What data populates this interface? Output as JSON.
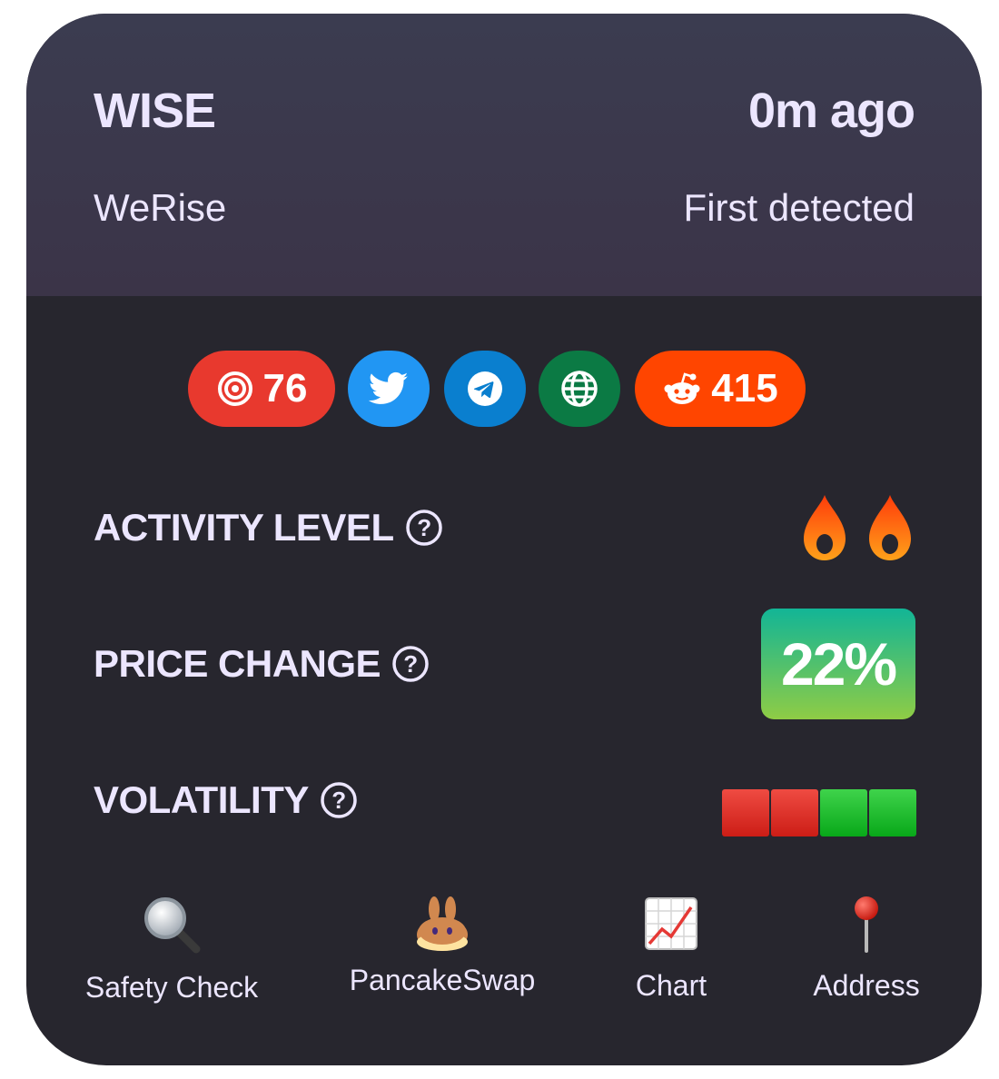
{
  "header": {
    "symbol": "WISE",
    "time_ago": "0m ago",
    "token_name": "WeRise",
    "detected_label": "First detected"
  },
  "badges": {
    "score": "76",
    "reddit": "415",
    "colors": {
      "score": "#e8392e",
      "twitter": "#2196f3",
      "telegram": "#0a7fcf",
      "website": "#0b7a44",
      "reddit": "#ff4500"
    }
  },
  "metrics": {
    "activity": {
      "label": "ACTIVITY LEVEL",
      "flames": 2
    },
    "price_change": {
      "label": "PRICE CHANGE",
      "value": "22%"
    },
    "volatility": {
      "label": "VOLATILITY",
      "segments": [
        "red",
        "red",
        "green",
        "green"
      ]
    }
  },
  "links": [
    {
      "label": "Safety Check",
      "icon": "magnifier-icon"
    },
    {
      "label": "PancakeSwap",
      "icon": "pancake-bunny-icon"
    },
    {
      "label": "Chart",
      "icon": "chart-increasing-icon"
    },
    {
      "label": "Address",
      "icon": "pushpin-icon"
    }
  ]
}
